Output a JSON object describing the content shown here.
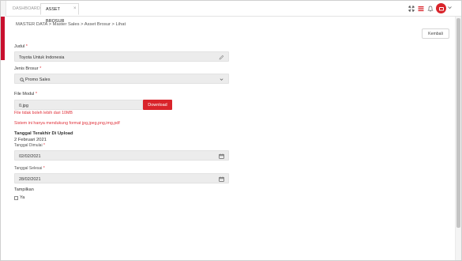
{
  "tabs": {
    "dashboard": "DASHBOARD",
    "active": "ASSET BROSUR",
    "close": "×"
  },
  "breadcrumb": "MASTER DATA > Master Sales > Asset Brosur > Lihat",
  "buttons": {
    "kembali": "Kembali",
    "download": "Download"
  },
  "form": {
    "judul_label": "Judul",
    "judul_value": "Toyota Untuk Indonesia",
    "jenis_label": "Jenis Brosur",
    "jenis_value": "Promo Sales",
    "file_label": "File Modul",
    "file_value": "0.jpg",
    "file_error_size": "File tidak boleh lebih dari 10MB",
    "file_error_format": "Sistem ini hanya mendukung format jpg,jpeg,png,img,pdf",
    "last_upload_heading": "Tanggal Terakhir Di Upload",
    "last_upload_value": "2 Februari 2021",
    "mulai_label": "Tanggal Dimulai",
    "mulai_value": "02/02/2021",
    "selesai_label": "Tanggal Selesai",
    "selesai_value": "28/02/2021",
    "tampilkan_label": "Tampilkan",
    "ya_label": "Ya",
    "required_mark": "*"
  },
  "colors": {
    "accent": "#d9242b",
    "error": "#e0323b"
  },
  "icons": [
    "expand-icon",
    "list-icon",
    "bell-icon",
    "user-icon",
    "chevron-down-icon",
    "pencil-icon",
    "search-icon",
    "calendar-icon"
  ]
}
